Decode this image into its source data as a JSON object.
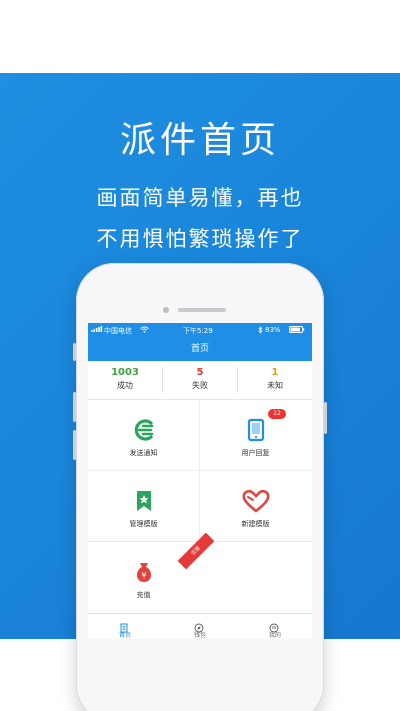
{
  "promo": {
    "title": "派件首页",
    "line1": "画面简单易懂，再也",
    "line2": "不用惧怕繁琐操作了"
  },
  "status_bar": {
    "carrier": "中国电信",
    "time": "下午5:29",
    "battery": "83%"
  },
  "nav": {
    "title": "首页"
  },
  "stats": [
    {
      "value": "1003",
      "label": "成功",
      "color": "#3da33a"
    },
    {
      "value": "5",
      "label": "失败",
      "color": "#e03a3a"
    },
    {
      "value": "1",
      "label": "未知",
      "color": "#e3a11a"
    }
  ],
  "grid": {
    "send_notice": "发送通知",
    "user_reply": "用户回复",
    "user_reply_badge": "12",
    "manage_template": "管理模版",
    "new_template": "新建模版",
    "recharge": "充值",
    "recharge_ribbon": "优惠"
  },
  "tabs": [
    {
      "label": "首页",
      "icon": "document-icon",
      "active": true
    },
    {
      "label": "钱包",
      "icon": "compass-icon",
      "active": false
    },
    {
      "label": "我的",
      "icon": "user-icon",
      "active": false
    }
  ],
  "colors": {
    "background_blue": "#1a86db",
    "nav_blue": "#1e8ee6",
    "green": "#2aa55a",
    "red": "#e03a3a"
  }
}
